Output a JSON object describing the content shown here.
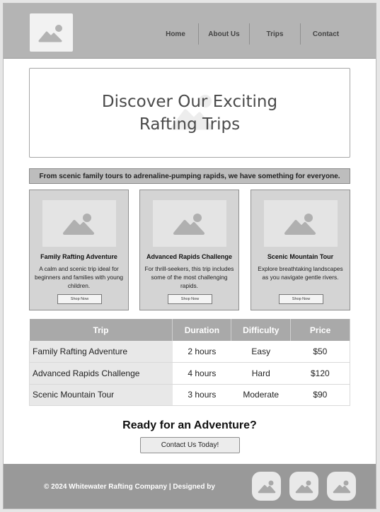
{
  "header": {
    "logo_icon": "image-placeholder-icon",
    "nav": [
      "Home",
      "About Us",
      "Trips",
      "Contact"
    ]
  },
  "hero": {
    "title": "Discover Our Exciting Rafting Trips",
    "background_icon": "image-placeholder-icon"
  },
  "tagline": "From scenic family tours to adrenaline-pumping rapids, we have something for everyone.",
  "cards": [
    {
      "image_icon": "image-placeholder-icon",
      "title": "Family Rafting Adventure",
      "description": "A calm and scenic trip ideal for beginners and families with young children.",
      "button": "Shop Now"
    },
    {
      "image_icon": "image-placeholder-icon",
      "title": "Advanced Rapids Challenge",
      "description": "For thrill-seekers, this trip includes some of the most challenging rapids.",
      "button": "Shop Now"
    },
    {
      "image_icon": "image-placeholder-icon",
      "title": "Scenic Mountain Tour",
      "description": "Explore breathtaking landscapes as you navigate gentle rivers.",
      "button": "Shop Now"
    }
  ],
  "table": {
    "headers": [
      "Trip",
      "Duration",
      "Difficulty",
      "Price"
    ],
    "rows": [
      [
        "Family Rafting Adventure",
        "2 hours",
        "Easy",
        "$50"
      ],
      [
        "Advanced Rapids Challenge",
        "4 hours",
        "Hard",
        "$120"
      ],
      [
        "Scenic Mountain Tour",
        "3 hours",
        "Moderate",
        "$90"
      ]
    ]
  },
  "cta": {
    "title": "Ready for an Adventure?",
    "button": "Contact Us Today!"
  },
  "footer": {
    "copyright": "© 2024 Whitewater Rafting Company | Designed by",
    "social_icons": [
      "image-placeholder-icon",
      "image-placeholder-icon",
      "image-placeholder-icon"
    ]
  },
  "colors": {
    "header_bg": "#b4b4b4",
    "footer_bg": "#999999",
    "card_bg": "#d4d4d4",
    "table_header_bg": "#a9a9a9"
  }
}
